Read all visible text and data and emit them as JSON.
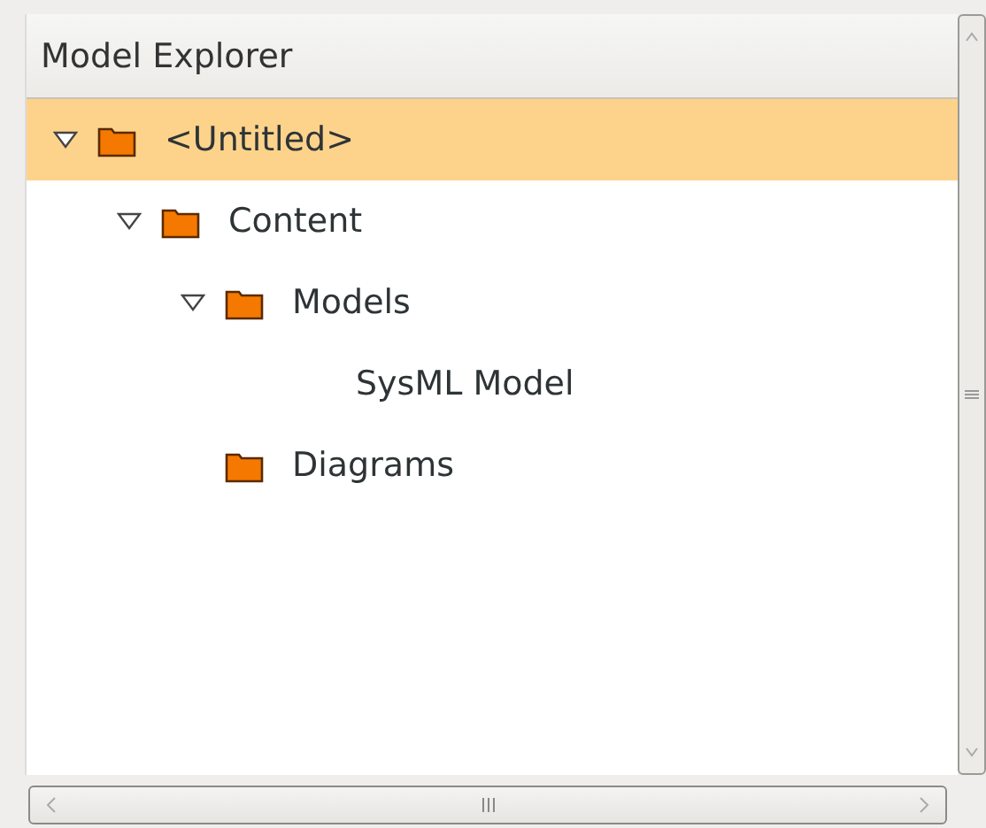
{
  "panel": {
    "title": "Model Explorer"
  },
  "tree": [
    {
      "label": "<Untitled>",
      "kind": "folder",
      "selected": true,
      "expanded": true,
      "children": [
        {
          "label": "Content",
          "kind": "folder",
          "selected": false,
          "expanded": true,
          "children": [
            {
              "label": "Models",
              "kind": "folder",
              "selected": false,
              "expanded": true,
              "children": [
                {
                  "label": "SysML Model",
                  "selected": false
                }
              ]
            },
            {
              "label": "Diagrams",
              "kind": "folder",
              "selected": false
            }
          ]
        }
      ]
    }
  ]
}
